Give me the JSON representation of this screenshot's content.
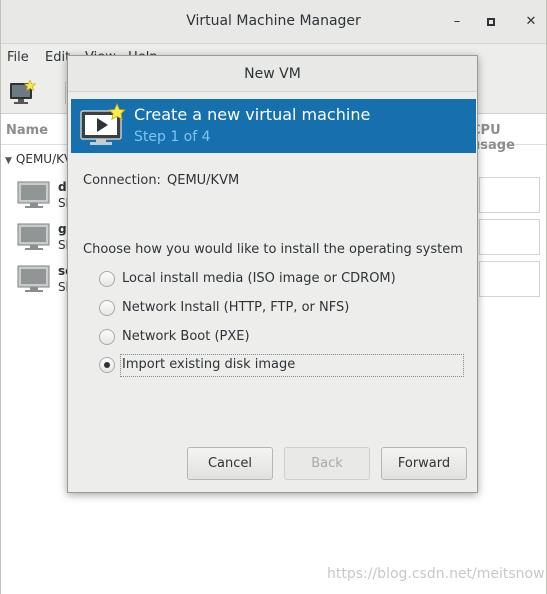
{
  "main_window": {
    "title": "Virtual Machine Manager",
    "menu": [
      "File",
      "Edit",
      "View",
      "Help"
    ],
    "list_header": {
      "name": "Name",
      "cpu": "CPU usage"
    },
    "group": "QEMU/KVM",
    "vms": [
      {
        "name": "deepin",
        "state": "Shutoff"
      },
      {
        "name": "generic",
        "state": "Shutoff"
      },
      {
        "name": "server",
        "state": "Shutoff"
      }
    ]
  },
  "dialog": {
    "title": "New VM",
    "banner_title": "Create a new virtual machine",
    "banner_step": "Step 1 of 4",
    "connection_label": "Connection:",
    "connection_value": "QEMU/KVM",
    "choose_label": "Choose how you would like to install the operating system",
    "options": [
      {
        "label": "Local install media (ISO image or CDROM)",
        "checked": false
      },
      {
        "label": "Network Install (HTTP, FTP, or NFS)",
        "checked": false
      },
      {
        "label": "Network Boot (PXE)",
        "checked": false
      },
      {
        "label": "Import existing disk image",
        "checked": true
      }
    ],
    "buttons": {
      "cancel": "Cancel",
      "back": "Back",
      "forward": "Forward"
    }
  },
  "watermark": "https://blog.csdn.net/meitsnow",
  "colors": {
    "banner": "#1670ad",
    "banner_sub": "#7ec3f2"
  }
}
